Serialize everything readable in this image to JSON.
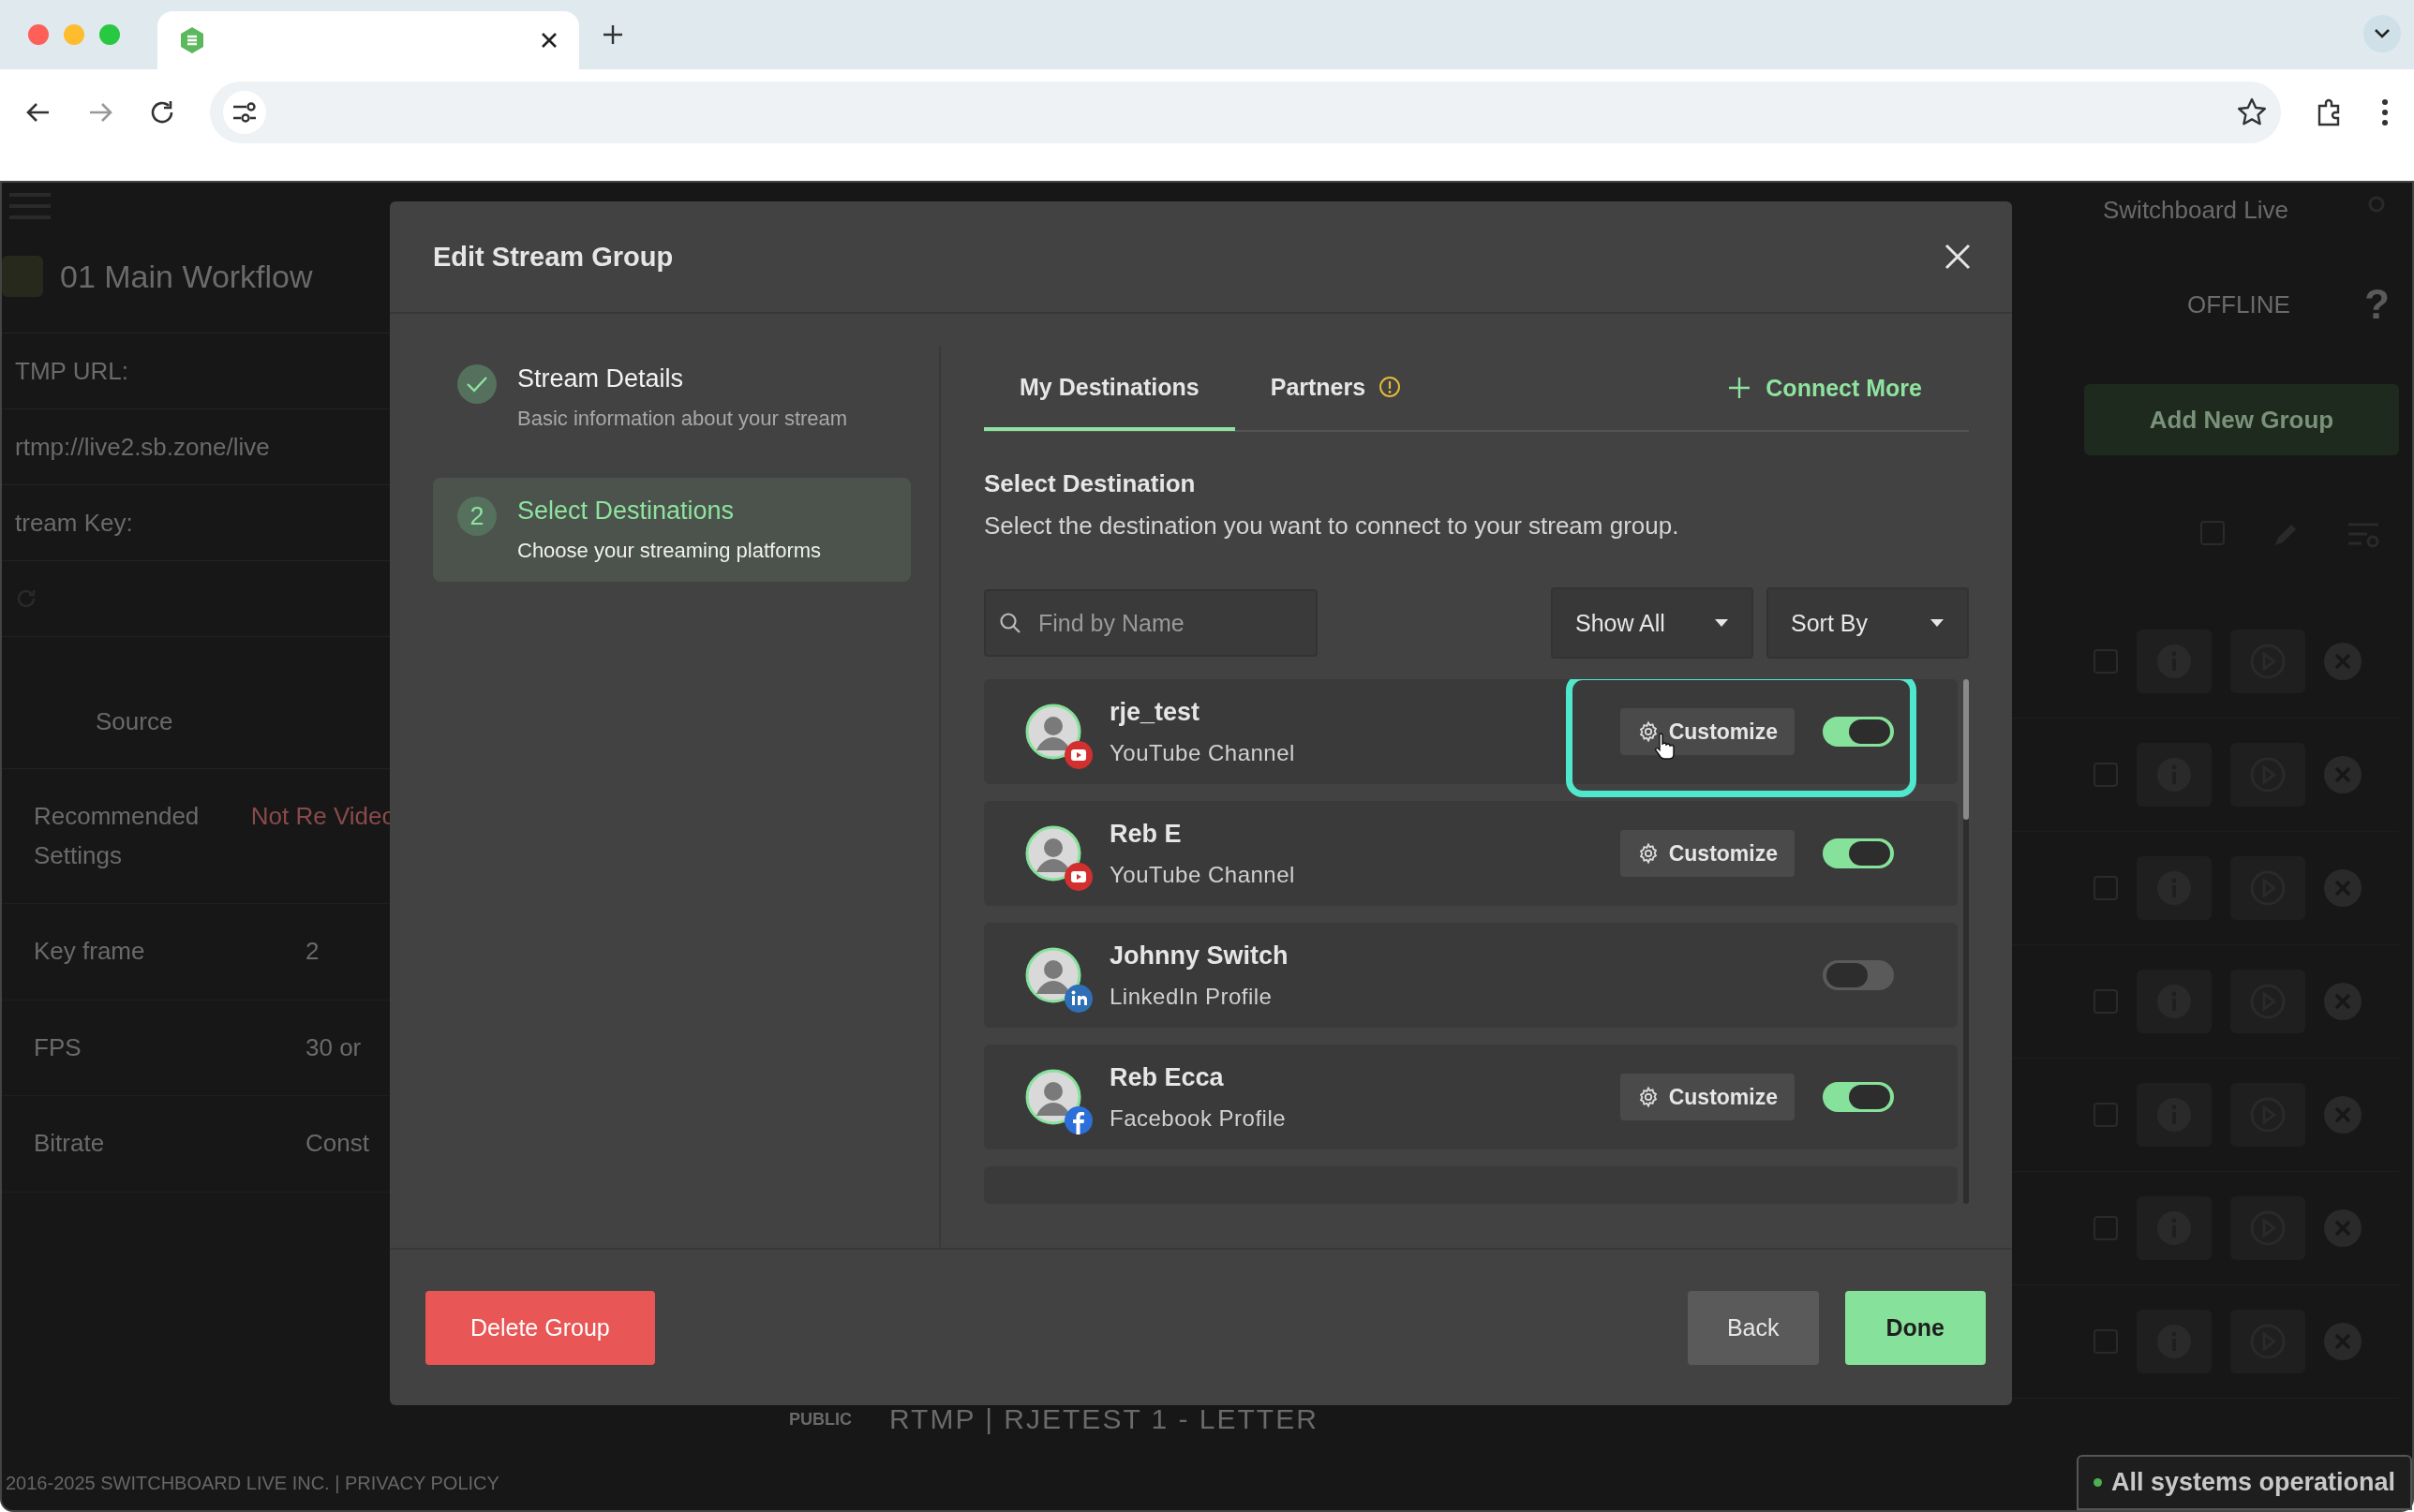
{
  "background": {
    "brand": "Switchboard Live",
    "workflow": "01 Main Workflow",
    "status": "OFFLINE",
    "help": "?",
    "add_group": "Add New Group",
    "fields": [
      {
        "label": "TMP URL:",
        "value": "rtmp://live2.sb.zone/live"
      },
      {
        "label": "tream Key:"
      }
    ],
    "source_tab": "Source",
    "settings": [
      {
        "label": "Recommended Settings",
        "value": "Not Re Video",
        "warn": true
      },
      {
        "label": "Key frame",
        "value": "2",
        "warn": false
      },
      {
        "label": "FPS",
        "value": "30 or",
        "warn": false
      },
      {
        "label": "Bitrate",
        "value": "Const",
        "warn": false
      }
    ],
    "select_all_checked": false,
    "rows": [
      {
        "checked": false
      },
      {
        "checked": false
      },
      {
        "checked": false
      },
      {
        "checked": false
      },
      {
        "checked": false
      },
      {
        "checked": false
      },
      {
        "checked": false
      }
    ],
    "public_badge": "PUBLIC",
    "destination_line": "RTMP | RJETEST 1 - LETTER",
    "footer": "2016-2025 SWITCHBOARD LIVE INC. | PRIVACY POLICY"
  },
  "modal": {
    "title": "Edit Stream Group",
    "steps": [
      {
        "kind": "done",
        "title": "Stream Details",
        "subtitle": "Basic information about your stream",
        "selected": false
      },
      {
        "kind": "number",
        "number": "2",
        "title": "Select Destinations",
        "subtitle": "Choose your streaming platforms",
        "selected": true
      }
    ],
    "tabs": [
      {
        "label": "My Destinations",
        "selected": true,
        "info": false
      },
      {
        "label": "Partners",
        "selected": false,
        "info": true
      }
    ],
    "connect_more": "Connect More",
    "section_title": "Select Destination",
    "section_description": "Select the destination you want to connect to your stream group.",
    "search": {
      "placeholder": "Find by Name"
    },
    "filters": [
      "Show All",
      "Sort By"
    ],
    "destinations": [
      {
        "name": "rje_test",
        "platform": "YouTube Channel",
        "kind": "youtube",
        "customize": "Customize",
        "on": true,
        "highlighted": true
      },
      {
        "name": "Reb E",
        "platform": "YouTube Channel",
        "kind": "youtube",
        "customize": "Customize",
        "on": true,
        "highlighted": false
      },
      {
        "name": "Johnny Switch",
        "platform": "LinkedIn Profile",
        "kind": "linkedin",
        "on": false,
        "highlighted": false
      },
      {
        "name": "Reb Ecca",
        "platform": "Facebook Profile",
        "kind": "facebook",
        "customize": "Customize",
        "on": true,
        "highlighted": false
      }
    ],
    "delete": "Delete Group",
    "back": "Back",
    "done": "Done"
  },
  "system_status": "All systems operational"
}
